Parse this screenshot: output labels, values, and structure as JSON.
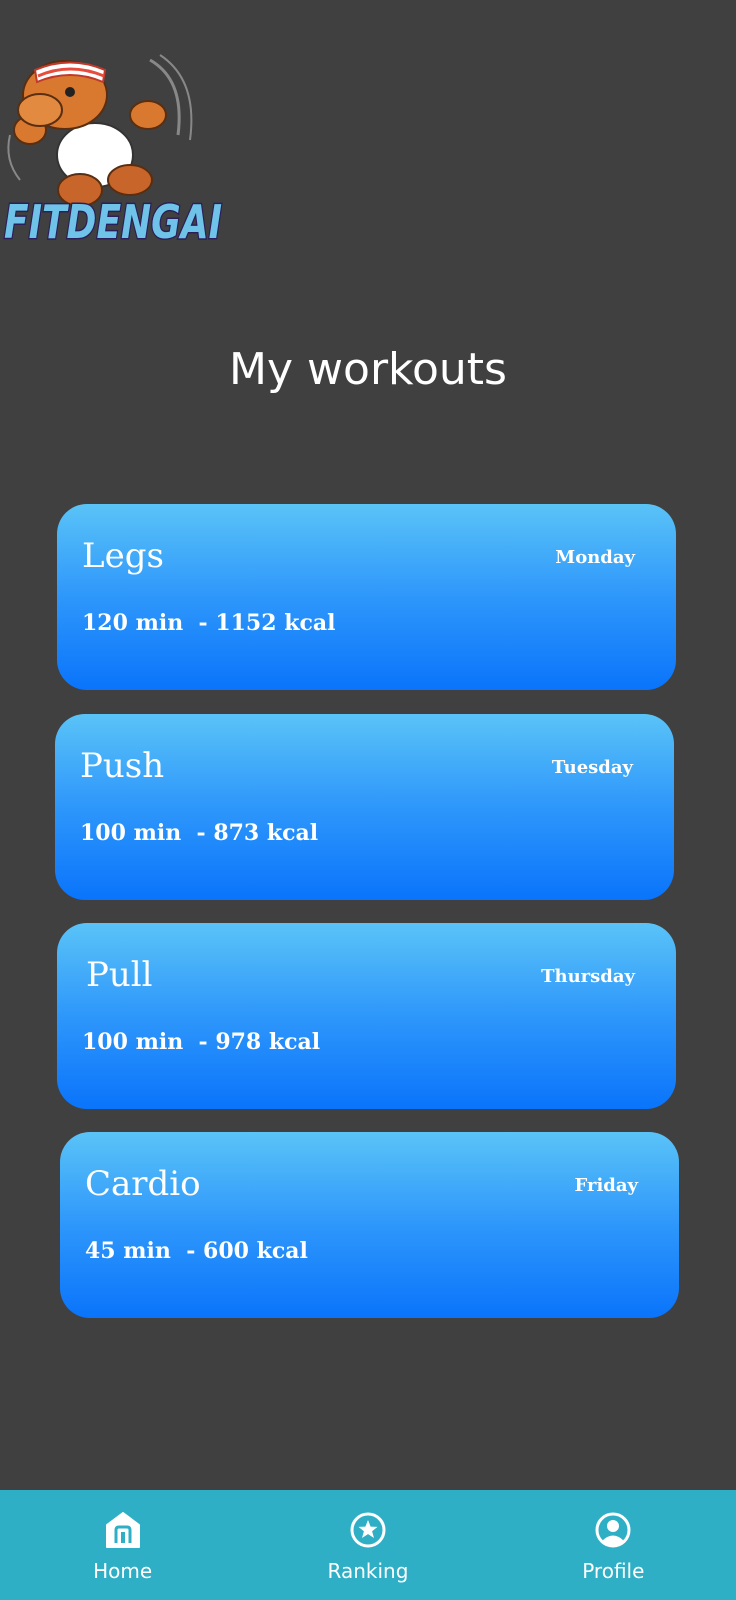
{
  "app": {
    "logo_text": "FITDENGAI"
  },
  "page": {
    "title": "My workouts"
  },
  "workouts": [
    {
      "name": "Legs",
      "day": "Monday",
      "stats": "120 min  - 1152 kcal"
    },
    {
      "name": "Push",
      "day": "Tuesday",
      "stats": "100 min  - 873 kcal"
    },
    {
      "name": "Pull",
      "day": "Thursday",
      "stats": "100 min  - 978 kcal"
    },
    {
      "name": "Cardio",
      "day": "Friday",
      "stats": "45 min  - 600 kcal"
    }
  ],
  "nav": {
    "items": [
      {
        "label": "Home",
        "icon": "home-icon"
      },
      {
        "label": "Ranking",
        "icon": "star-circle-icon"
      },
      {
        "label": "Profile",
        "icon": "user-circle-icon"
      }
    ]
  },
  "colors": {
    "background": "#404040",
    "card_gradient_top": "#5ac3f7",
    "card_gradient_bottom": "#0a74fb",
    "nav_background": "#2eafc6",
    "text": "#ffffff"
  }
}
